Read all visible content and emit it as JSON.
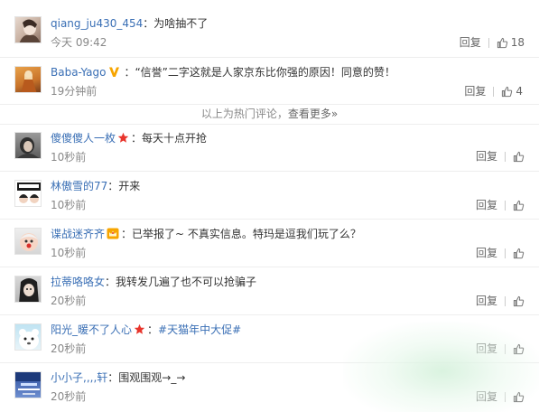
{
  "comments": [
    {
      "username": "qiang_ju430_454",
      "sep": "：",
      "text": "为啥抽不了",
      "time": "今天 09:42",
      "reply": "回复",
      "likes": "18"
    },
    {
      "username": "Baba-Yago",
      "sep": "：",
      "text": "“信誉”二字这就是人家京东比你强的原因！同意的赞！",
      "time": "19分钟前",
      "reply": "回复",
      "likes": "4"
    },
    {
      "username": "傻傻傻人一枚",
      "sep": "：",
      "text": "每天十点开抢",
      "time": "10秒前",
      "reply": "回复",
      "likes": ""
    },
    {
      "username": "林傲雪的77",
      "sep": "：",
      "text": "开来",
      "time": "10秒前",
      "reply": "回复",
      "likes": ""
    },
    {
      "username": "谍战迷齐齐",
      "sep": "：",
      "text": "已举报了~ 不真实信息。特玛是逗我们玩了么？",
      "time": "10秒前",
      "reply": "回复",
      "likes": ""
    },
    {
      "username": "拉蒂咯咯女",
      "sep": "：",
      "text": "我转发几遍了也不可以抢骗子",
      "time": "20秒前",
      "reply": "回复",
      "likes": ""
    },
    {
      "username": "阳光_暖不了人心",
      "sep": "：",
      "text": "#天猫年中大促#",
      "time": "20秒前",
      "reply": "回复",
      "likes": ""
    },
    {
      "username": "小小子,,,,轩",
      "sep": "：",
      "text": "围观围观→_→",
      "time": "20秒前",
      "reply": "回复",
      "likes": ""
    }
  ],
  "hot_notice": {
    "prefix": "以上为热门评论，",
    "link": "查看更多»"
  },
  "colors": {
    "username": "#3a6fb5",
    "time": "#888888",
    "star": "#e8352c",
    "vbadge": "#f7a500"
  },
  "icons": {
    "like": "thumbs-up-icon",
    "verified": "verified-v-icon",
    "member": "star-icon",
    "vip": "crown-icon"
  }
}
